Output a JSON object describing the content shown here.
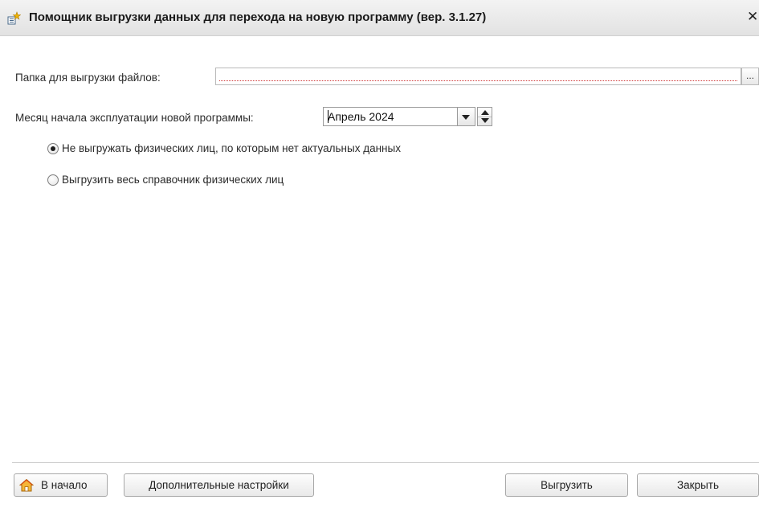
{
  "window": {
    "title": "Помощник выгрузки данных для перехода на новую программу (вер. 3.1.27)",
    "close_glyph": "✕"
  },
  "form": {
    "folder_label": "Папка для выгрузки файлов:",
    "folder_value": "",
    "folder_browse_label": "...",
    "month_label": "Месяц начала эксплуатации новой программы:",
    "month_value": "Апрель 2024"
  },
  "options": [
    {
      "label": "Не выгружать физических лиц, по которым нет актуальных данных",
      "selected": true
    },
    {
      "label": "Выгрузить весь справочник физических лиц",
      "selected": false
    }
  ],
  "footer": {
    "home_label": "В начало",
    "settings_label": "Дополнительные настройки",
    "export_label": "Выгрузить",
    "close_label": "Закрыть"
  },
  "icons": {
    "title": "export-wizard-icon",
    "home": "home-icon",
    "dropdown": "chevron-down-icon",
    "spin_up": "spin-up-icon",
    "spin_down": "spin-down-icon"
  },
  "colors": {
    "required_underline": "#d03a3a",
    "titlebar": "#e9e9e9"
  }
}
